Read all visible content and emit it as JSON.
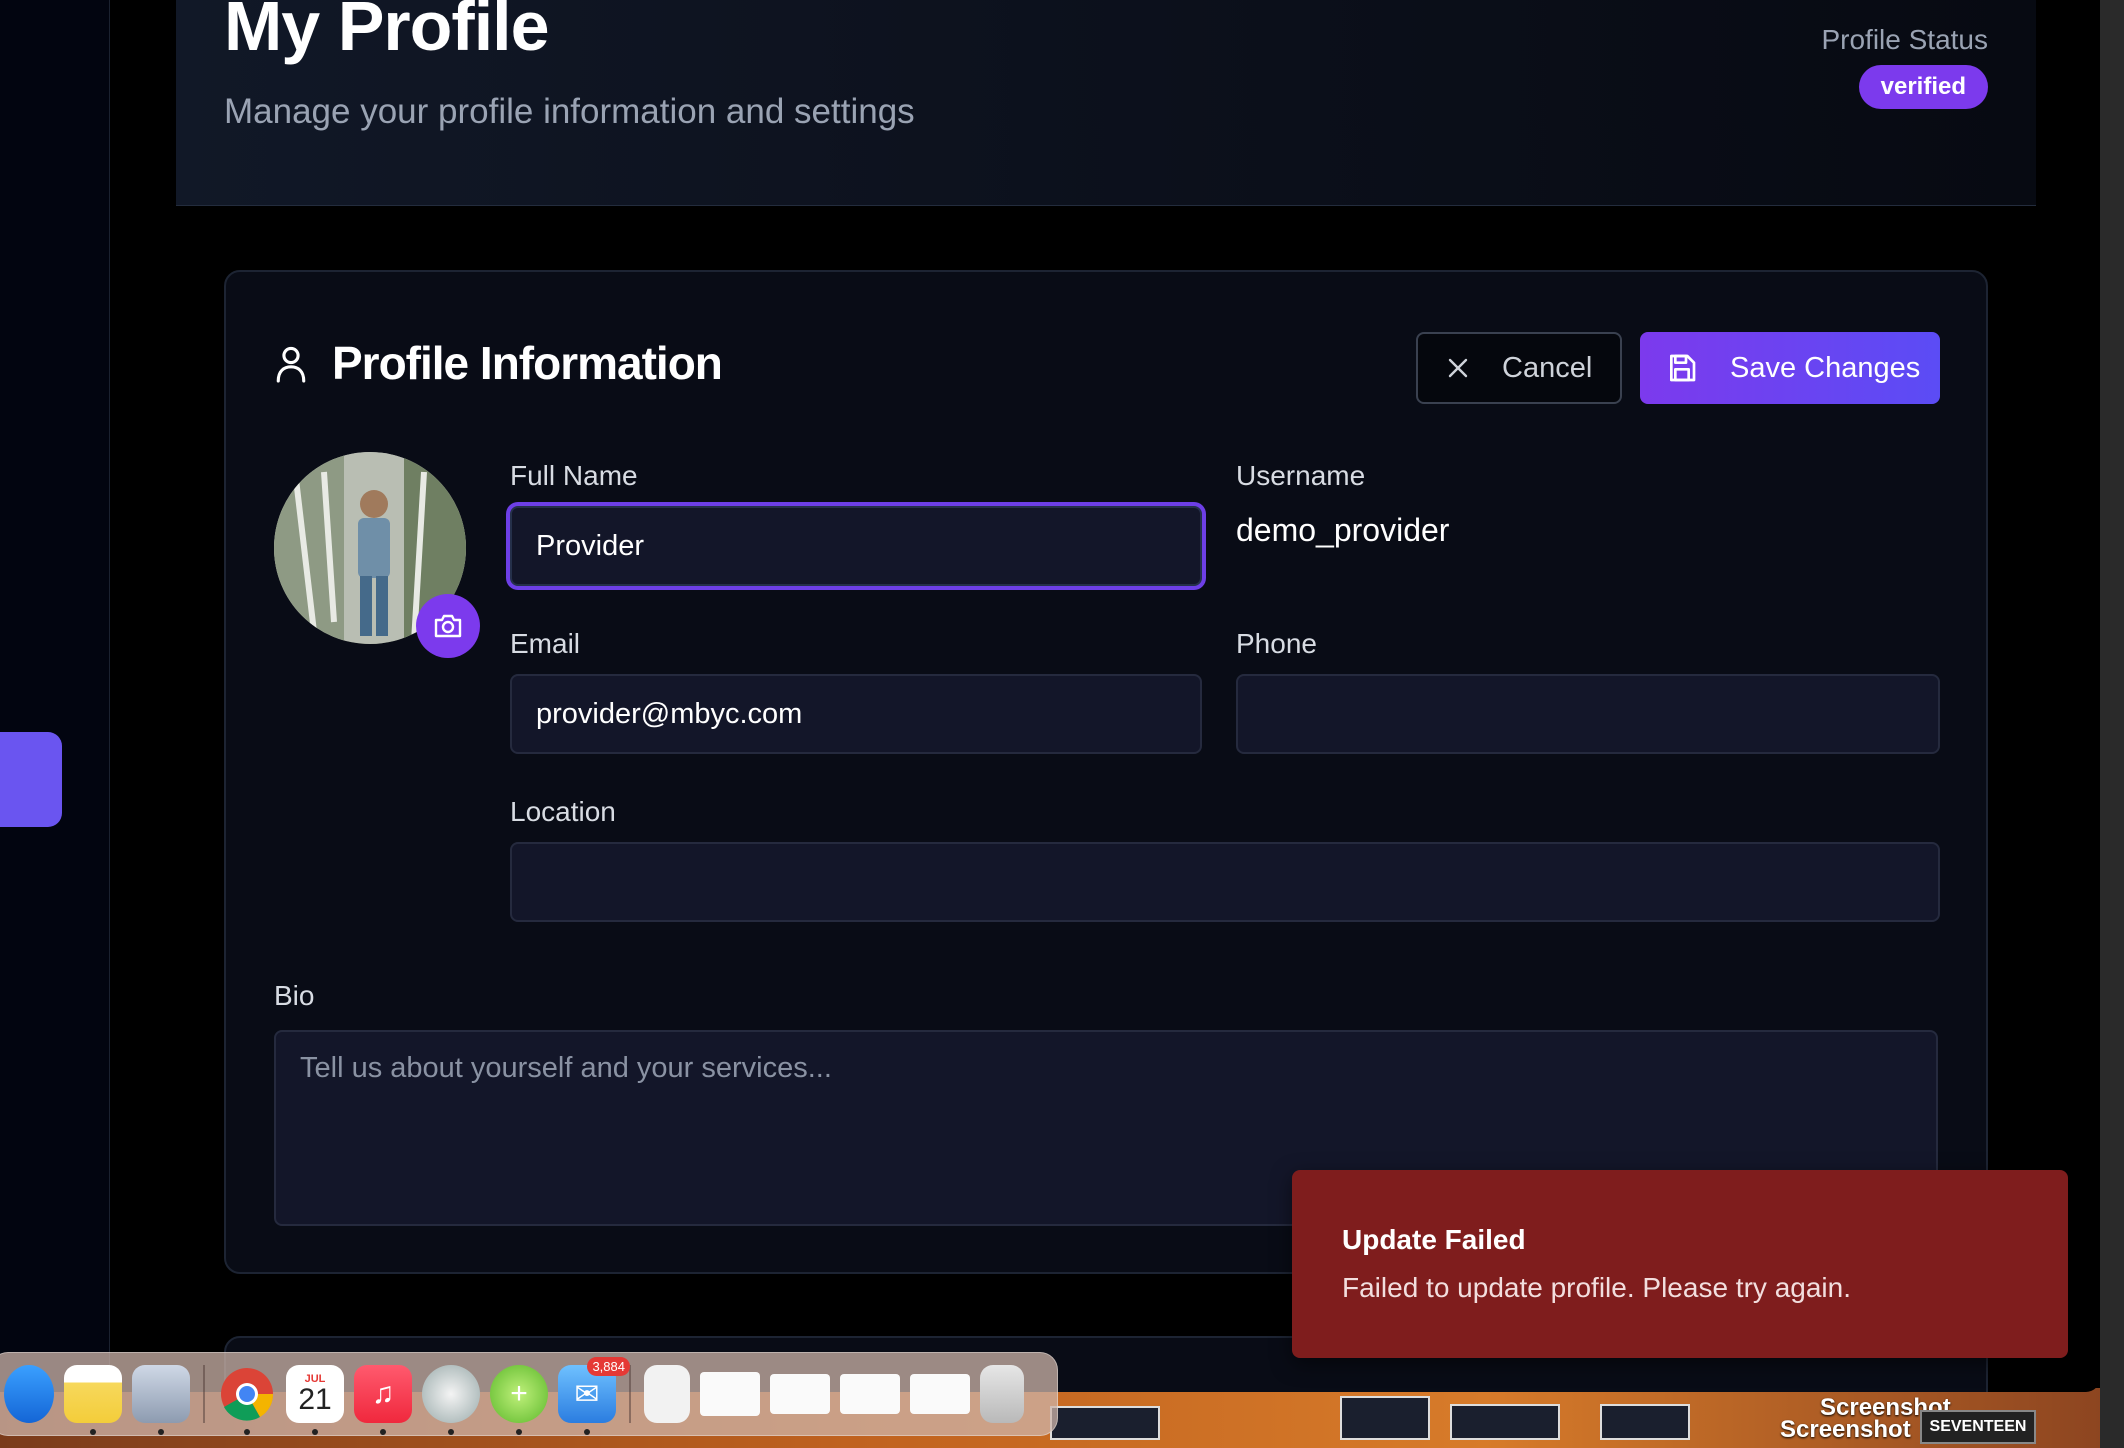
{
  "header": {
    "title": "My Profile",
    "subtitle": "Manage your profile information and settings",
    "status_label": "Profile Status",
    "status_value": "verified"
  },
  "card": {
    "title": "Profile Information",
    "cancel_label": "Cancel",
    "save_label": "Save Changes"
  },
  "fields": {
    "full_name": {
      "label": "Full Name",
      "value": "Provider"
    },
    "username": {
      "label": "Username",
      "value": "demo_provider"
    },
    "email": {
      "label": "Email",
      "value": "provider@mbyc.com"
    },
    "phone": {
      "label": "Phone",
      "value": ""
    },
    "location": {
      "label": "Location",
      "value": ""
    },
    "bio": {
      "label": "Bio",
      "value": "",
      "placeholder": "Tell us about yourself and your services..."
    }
  },
  "toast": {
    "title": "Update Failed",
    "message": "Failed to update profile. Please try again."
  },
  "dock": {
    "calendar_month": "JUL",
    "calendar_day": "21",
    "mail_badge": "3,884"
  },
  "desktop": {
    "label_1": "Screenshot",
    "label_2": "Screenshot",
    "label_3": "SEVENTEEN"
  },
  "colors": {
    "accent": "#7c3aed",
    "toast_bg": "#7f1d1d",
    "card_bg": "#090c16",
    "input_bg": "#131629"
  }
}
